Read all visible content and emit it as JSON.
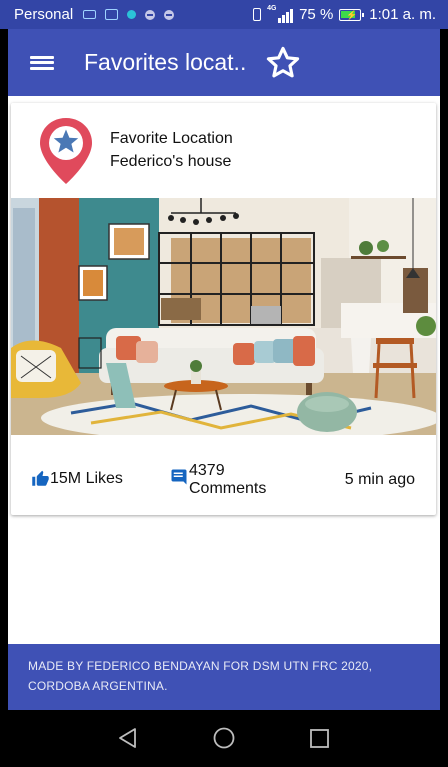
{
  "status_bar": {
    "carrier": "Personal",
    "battery_percent": "75 %",
    "network_type": "4G",
    "time": "1:01 a. m."
  },
  "app_bar": {
    "title": "Favorites locat..",
    "menu_icon": "hamburger-menu-icon",
    "action_icon": "star-outline-icon"
  },
  "card": {
    "line1": "Favorite Location",
    "line2": "Federico's house",
    "pin_icon": "location-pin-star-icon",
    "likes": "15M Likes",
    "comments": "4379 Comments",
    "time_ago": "5 min ago"
  },
  "footer": {
    "text": "MADE BY FEDERICO BENDAYAN FOR DSM UTN FRC 2020, CORDOBA ARGENTINA."
  },
  "colors": {
    "primary": "#3f51b5",
    "status_bar": "#3345a6",
    "pin_red": "#e04a5c",
    "icon_blue": "#1565c0"
  }
}
